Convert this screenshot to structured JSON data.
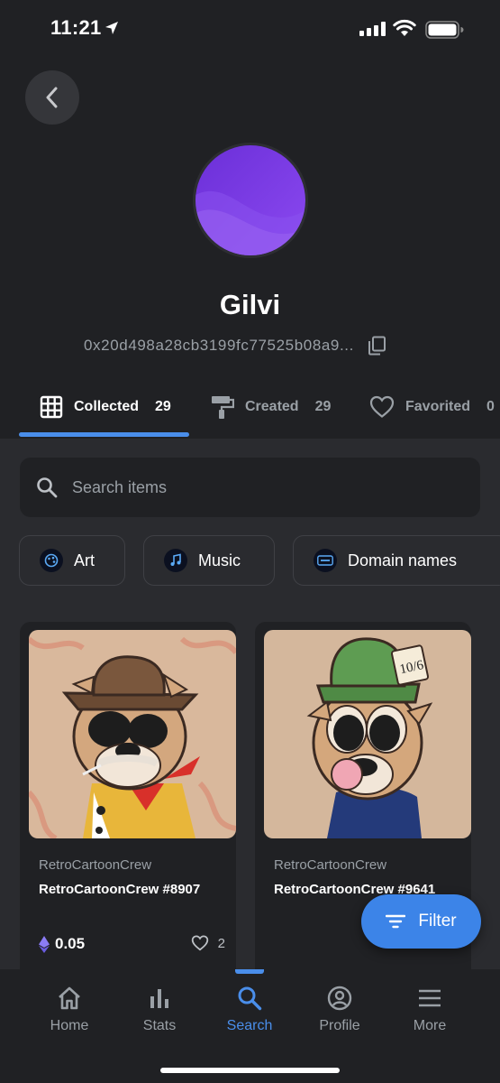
{
  "status_bar": {
    "time": "11:21"
  },
  "profile": {
    "name": "Gilvi",
    "wallet": "0x20d498a28cb3199fc77525b08a9..."
  },
  "tabs": [
    {
      "label": "Collected",
      "count": "29",
      "icon": "grid-icon",
      "active": true
    },
    {
      "label": "Created",
      "count": "29",
      "icon": "paint-roller-icon",
      "active": false
    },
    {
      "label": "Favorited",
      "count": "0",
      "icon": "heart-icon",
      "active": false
    }
  ],
  "search": {
    "placeholder": "Search items"
  },
  "chips": [
    {
      "label": "Art",
      "icon": "art-icon"
    },
    {
      "label": "Music",
      "icon": "music-icon"
    },
    {
      "label": "Domain names",
      "icon": "domain-icon"
    }
  ],
  "cards": [
    {
      "collection": "RetroCartoonCrew",
      "title": "RetroCartoonCrew #8907",
      "price": "0.05",
      "likes": "2"
    },
    {
      "collection": "RetroCartoonCrew",
      "title": "RetroCartoonCrew #9641"
    }
  ],
  "filter_button": {
    "label": "Filter"
  },
  "bottom_nav": [
    {
      "label": "Home",
      "icon": "home-icon"
    },
    {
      "label": "Stats",
      "icon": "stats-icon"
    },
    {
      "label": "Search",
      "icon": "search-icon",
      "active": true
    },
    {
      "label": "Profile",
      "icon": "profile-icon"
    },
    {
      "label": "More",
      "icon": "menu-icon"
    }
  ],
  "colors": {
    "background": "#202124",
    "content_bg": "#2a2b2f",
    "accent": "#3c84e8",
    "avatar": "#7b3fe4"
  }
}
